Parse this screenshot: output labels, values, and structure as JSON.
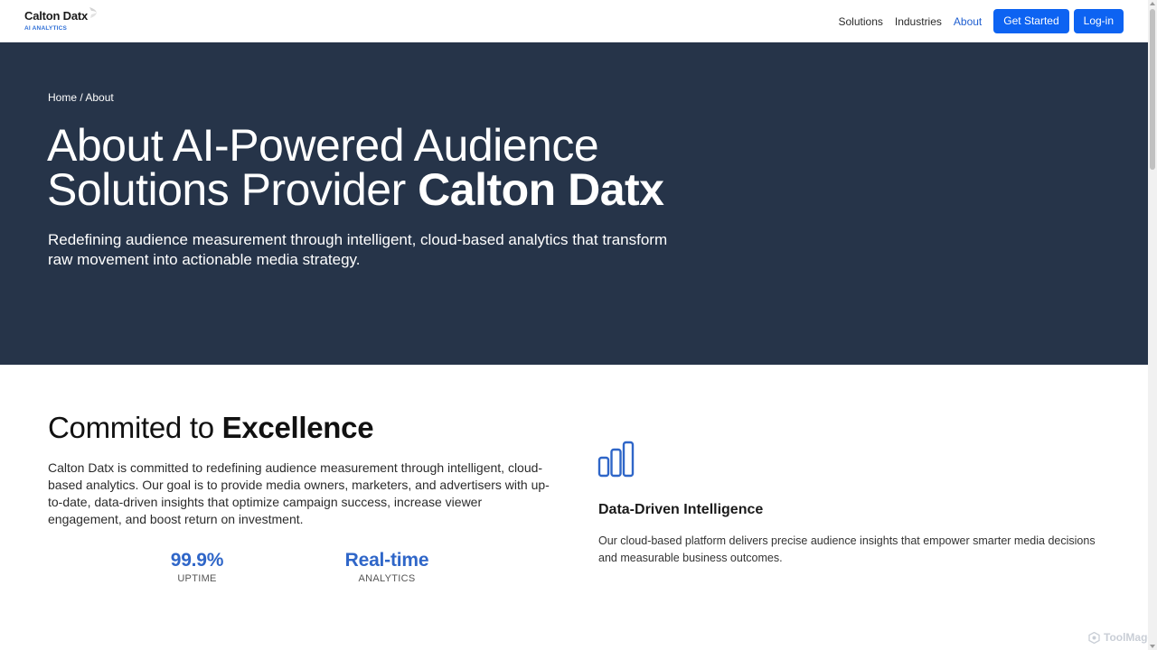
{
  "header": {
    "logo_name": "Calton Datx",
    "logo_sub": "AI ANALYTICS",
    "nav": [
      {
        "label": "Solutions"
      },
      {
        "label": "Industries"
      },
      {
        "label": "About"
      }
    ],
    "get_started_label": "Get Started",
    "login_label": "Log-in"
  },
  "hero": {
    "breadcrumb": "Home / About",
    "title_line1": "About AI-Powered Audience",
    "title_line2_prefix": "Solutions Provider ",
    "title_line2_bold": "Calton Datx",
    "subtitle": "Redefining audience measurement through intelligent, cloud-based analytics that transform raw movement into actionable media strategy."
  },
  "commitment": {
    "title_prefix": "Commited to ",
    "title_bold": "Excellence",
    "text": "Calton Datx is committed to redefining audience measurement through intelligent, cloud-based analytics. Our goal is to provide media owners, marketers, and advertisers with up-to-date, data-driven insights that optimize campaign success, increase viewer engagement, and boost return on investment.",
    "stats": [
      {
        "value": "99.9%",
        "label": "UPTIME"
      },
      {
        "value": "Real-time",
        "label": "ANALYTICS"
      }
    ]
  },
  "feature": {
    "icon": "bar-chart-icon",
    "title": "Data-Driven Intelligence",
    "text": "Our cloud-based platform delivers precise audience insights that empower smarter media decisions and measurable business outcomes."
  },
  "watermark": "ToolMage",
  "colors": {
    "hero_bg": "#263449",
    "accent": "#0d63f2",
    "stat": "#2f66c8"
  }
}
